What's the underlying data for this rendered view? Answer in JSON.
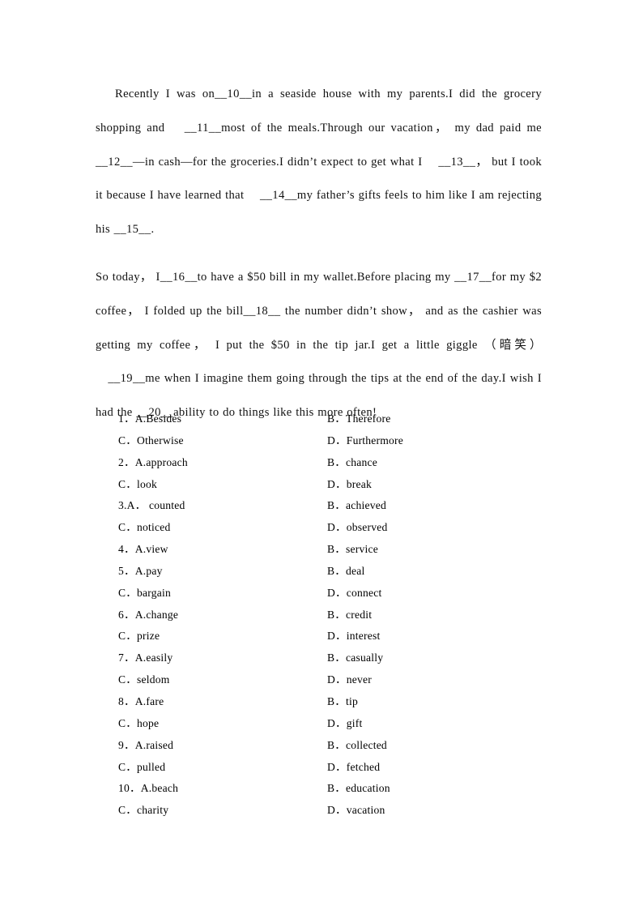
{
  "document": {
    "type": "cloze-test-worksheet",
    "page_background": "#ffffff",
    "text_color": "#111111"
  },
  "passage": {
    "paragraphs": [
      "Recently I was on__10__in a seaside house with my parents.I did the grocery shopping and 　__11__most of the meals.Through our vacation， my dad paid me __12__—in cash—for the groceries.I didn’t expect to get what I 　__13__， but I took it because I have learned that 　__14__my father’s gifts feels to him like I am rejecting his __15__.",
      "So today， I__16__to have a $50 bill in my wallet.Before placing my __17__for my $2 coffee， I folded up the bill__18__ the number didn’t show， and as the cashier was getting my coffee， I put the $50 in the tip jar.I get a little giggle （暗笑） 　__19__me when I imagine them going through the tips at the end of the day.I wish I had the __20__ability to do things like this more often!"
    ]
  },
  "options": {
    "rows": [
      {
        "left": "1．A.Besides",
        "right": "B．Therefore"
      },
      {
        "left": "C．Otherwise",
        "right": "D．Furthermore"
      },
      {
        "left": "2．A.approach",
        "right": "B．chance"
      },
      {
        "left": "C．look",
        "right": "D．break"
      },
      {
        "left": "3.A． counted",
        "right": "B．achieved"
      },
      {
        "left": "C．noticed",
        "right": "D．observed"
      },
      {
        "left": "4．A.view",
        "right": "B．service"
      },
      {
        "left": "5．A.pay",
        "right": "B．deal"
      },
      {
        "left": "C．bargain",
        "right": "D．connect"
      },
      {
        "left": "6．A.change",
        "right": "B．credit"
      },
      {
        "left": "C．prize",
        "right": "D．interest"
      },
      {
        "left": "7．A.easily",
        "right": "B．casually"
      },
      {
        "left": "C．seldom",
        "right": "D．never"
      },
      {
        "left": "8．A.fare",
        "right": "B．tip"
      },
      {
        "left": "C．hope",
        "right": "D．gift"
      },
      {
        "left": "9．A.raised",
        "right": "B．collected"
      },
      {
        "left": "C．pulled",
        "right": "D．fetched"
      },
      {
        "left": "10．A.beach",
        "right": "B．education"
      },
      {
        "left": "C．charity",
        "right": "D．vacation"
      }
    ]
  }
}
